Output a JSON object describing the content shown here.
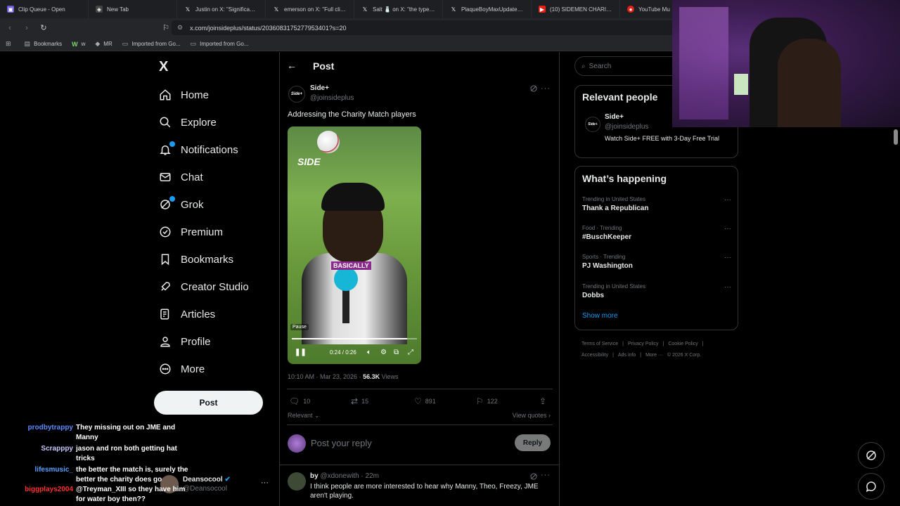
{
  "browser": {
    "tabs": [
      {
        "title": "Clip Queue - Open",
        "color": "#6b5bd6"
      },
      {
        "title": "New Tab",
        "color": "#444"
      },
      {
        "title": "Justin on X: \"Significantly",
        "color": "#000"
      },
      {
        "title": "emerson on X: \"Full clip of",
        "color": "#000"
      },
      {
        "title": "Salt 🧂 on X: \"the type of",
        "color": "#000"
      },
      {
        "title": "PlaqueBoyMaxUpdates on",
        "color": "#000"
      },
      {
        "title": "(10) SIDEMEN CHARITY M",
        "color": "#e62117"
      },
      {
        "title": "YouTube Mu",
        "color": "#e62117"
      }
    ],
    "url": "x.com/joinsideplus/status/2036083175277953401?s=20",
    "bookmarks": [
      "Bookmarks",
      "w",
      "MR",
      "Imported from Go...",
      "Imported from Go..."
    ]
  },
  "sidebar": {
    "logo": "X",
    "items": [
      {
        "label": "Home",
        "icon": "home-icon"
      },
      {
        "label": "Explore",
        "icon": "search-icon"
      },
      {
        "label": "Notifications",
        "icon": "bell-icon",
        "badge": "1"
      },
      {
        "label": "Chat",
        "icon": "mail-icon"
      },
      {
        "label": "Grok",
        "icon": "grok-icon"
      },
      {
        "label": "Premium",
        "icon": "verified-icon"
      },
      {
        "label": "Bookmarks",
        "icon": "bookmark-icon"
      },
      {
        "label": "Creator Studio",
        "icon": "rocket-icon"
      },
      {
        "label": "Articles",
        "icon": "article-icon"
      },
      {
        "label": "Profile",
        "icon": "person-icon"
      },
      {
        "label": "More",
        "icon": "more-circle-icon"
      }
    ],
    "post_label": "Post"
  },
  "account": {
    "name": "Deansocool",
    "handle": "@Deansocool"
  },
  "main": {
    "header_title": "Post",
    "post": {
      "author_name": "Side+",
      "author_handle": "@joinsideplus",
      "avatar_text": "Side+",
      "text": "Addressing the Charity Match players",
      "video": {
        "brand": "SIDE",
        "caption": "BASICALLY",
        "pause_tip": "Pause",
        "time": "0:24 / 0:26",
        "progress": 0.92
      },
      "timestamp": "10:10 AM · Mar 23, 2026 · ",
      "views_count": "56.3K",
      "views_label": " Views",
      "replies": "10",
      "reposts": "15",
      "likes": "891",
      "bookmarks": "122"
    },
    "sort_label": "Relevant ⌄",
    "view_quotes": "View quotes ›",
    "reply_placeholder": "Post your reply",
    "reply_button": "Reply",
    "comment": {
      "author": "by",
      "handle_time": "@xdonewith · 22m",
      "text": "I think people are more interested to hear why Manny, Theo, Freezy, JME aren't playing."
    }
  },
  "right": {
    "search_placeholder": "Search",
    "relevant_title": "Relevant people",
    "relevant_person": {
      "name": "Side+",
      "handle": "@joinsideplus",
      "bio": "Watch Side+ FREE with 3-Day Free Trial",
      "avatar_text": "Side+"
    },
    "happening_title": "What’s happening",
    "trends": [
      {
        "category": "Trending in United States",
        "name": "Thank a Republican"
      },
      {
        "category": "Food · Trending",
        "name": "#BuschKeeper"
      },
      {
        "category": "Sports · Trending",
        "name": "PJ Washington"
      },
      {
        "category": "Trending in United States",
        "name": "Dobbs"
      }
    ],
    "show_more": "Show more",
    "footer": [
      "Terms of Service",
      "|",
      "Privacy Policy",
      "|",
      "Cookie Policy",
      "|",
      "Accessibility",
      "|",
      "Ads info",
      "|",
      "More ···",
      "© 2026 X Corp."
    ]
  },
  "stream_chat": [
    {
      "user": "prodbytrappy",
      "color": "#5b8cff",
      "text": "They missing out on JME and Manny"
    },
    {
      "user": "Scrapppy",
      "color": "#c9c9ff",
      "text": "jason and ron both getting hat tricks"
    },
    {
      "user": "lifesmusic_",
      "color": "#5aa0ff",
      "text": "the better the match is, surely the better the charity does go"
    },
    {
      "user": "biggplays2004",
      "color": "#ff3030",
      "text": "@Treyman_XIII so they have him for water boy then??"
    }
  ],
  "colors": {
    "accent": "#1d9bf0",
    "background": "#000000",
    "border": "#2f3336"
  }
}
